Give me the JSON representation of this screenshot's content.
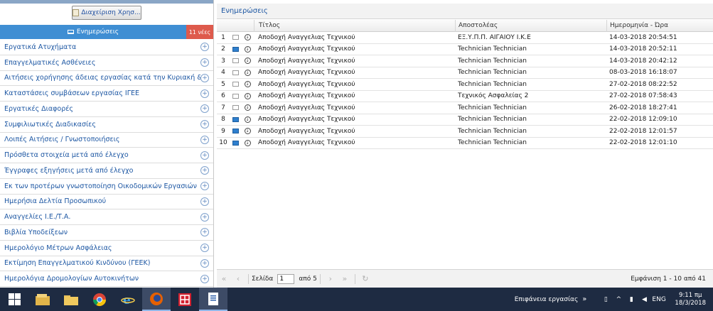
{
  "left": {
    "manager_button": "Διαχείριση Χρησ...",
    "notifications_label": "Ενημερώσεις",
    "notifications_badge": "11 νέες",
    "menu": [
      "Εργατικά Ατυχήματα",
      "Επαγγελματικές Ασθένειες",
      "Αιτήσεις χορήγησης άδειας εργασίας κατά την Κυριακή & ημέ...",
      "Καταστάσεις συμβάσεων εργασίας ΙΓΕΕ",
      "Εργατικές Διαφορές",
      "Συμφιλιωτικές Διαδικασίες",
      "Λοιπές Αιτήσεις / Γνωστοποιήσεις",
      "Πρόσθετα στοιχεία μετά από έλεγχο",
      "Έγγραφες εξηγήσεις μετά από έλεγχο",
      "Εκ των προτέρων γνωστοποίηση Οικοδομικών Εργασιών",
      "Ημερήσια Δελτία Προσωπικού",
      "Αναγγελίες Ι.Ε./Τ.Α.",
      "Βιβλία Υποδείξεων",
      "Ημερολόγιο Μέτρων Ασφάλειας",
      "Εκτίμηση Επαγγελματικού Κινδύνου (ΓΕΕΚ)",
      "Ημερολόγια Δρομολογίων Αυτοκινήτων"
    ]
  },
  "main": {
    "title": "Ενημερώσεις",
    "columns": {
      "title": "Τίτλος",
      "sender": "Αποστολέας",
      "date": "Ημερομηνία - Ώρα"
    },
    "rows": [
      {
        "num": "1",
        "read": true,
        "title": "Αποδοχή Αναγγελιας Τεχνικού",
        "sender": "ΕΞ.Υ.Π.Π. ΑΙΓΑΙΟΥ Ι.Κ.Ε",
        "date": "14-03-2018 20:54:51"
      },
      {
        "num": "2",
        "read": false,
        "title": "Αποδοχή Αναγγελιας Τεχνικού",
        "sender": "Technician Technician",
        "date": "14-03-2018 20:52:11"
      },
      {
        "num": "3",
        "read": true,
        "title": "Αποδοχή Αναγγελιας Τεχνικού",
        "sender": "Technician Technician",
        "date": "14-03-2018 20:42:12"
      },
      {
        "num": "4",
        "read": true,
        "title": "Αποδοχή Αναγγελιας Τεχνικού",
        "sender": "Technician Technician",
        "date": "08-03-2018 16:18:07"
      },
      {
        "num": "5",
        "read": true,
        "title": "Αποδοχή Αναγγελιας Τεχνικού",
        "sender": "Technician Technician",
        "date": "27-02-2018 08:22:52"
      },
      {
        "num": "6",
        "read": true,
        "title": "Αποδοχή Αναγγελιας Τεχνικού",
        "sender": "Τεχνικός Ασφαλείας 2",
        "date": "27-02-2018 07:58:43"
      },
      {
        "num": "7",
        "read": true,
        "title": "Αποδοχή Αναγγελιας Τεχνικού",
        "sender": "Technician Technician",
        "date": "26-02-2018 18:27:41"
      },
      {
        "num": "8",
        "read": false,
        "title": "Αποδοχή Αναγγελιας Τεχνικού",
        "sender": "Technician Technician",
        "date": "22-02-2018 12:09:10"
      },
      {
        "num": "9",
        "read": false,
        "title": "Αποδοχή Αναγγελιας Τεχνικού",
        "sender": "Technician Technician",
        "date": "22-02-2018 12:01:57"
      },
      {
        "num": "10",
        "read": false,
        "title": "Αποδοχή Αναγγελιας Τεχνικού",
        "sender": "Technician Technician",
        "date": "22-02-2018 12:01:10"
      }
    ],
    "pager": {
      "page_label": "Σελίδα",
      "page_value": "1",
      "of_label": "από 5",
      "info": "Εμφάνιση 1 - 10 από 41"
    }
  },
  "taskbar": {
    "desktop_label": "Επιφάνεια εργασίας",
    "language": "ENG",
    "time": "9:11 πμ",
    "date": "18/3/2018",
    "apps": [
      "windows-start",
      "file-explorer",
      "file-folder",
      "chrome",
      "internet-explorer",
      "firefox",
      "fortinet",
      "document-viewer"
    ]
  }
}
